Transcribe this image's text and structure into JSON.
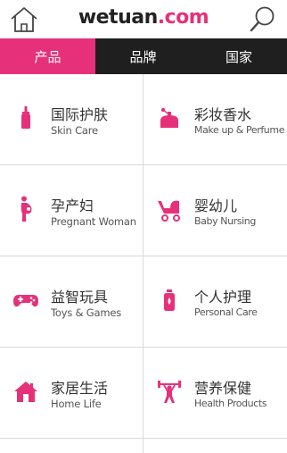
{
  "header": {
    "logo_part1": "wetuan",
    "logo_part2": ".com",
    "home_icon": "home-icon",
    "search_icon": "search-icon"
  },
  "tabs": [
    {
      "label": "产品",
      "active": true
    },
    {
      "label": "品牌",
      "active": false
    },
    {
      "label": "国家",
      "active": false
    }
  ],
  "categories": [
    {
      "zh": "国际护肤",
      "en": "Skin Care",
      "icon": "bottle-icon"
    },
    {
      "zh": "彩妆香水",
      "en": "Make up & Perfume",
      "icon": "perfume-icon"
    },
    {
      "zh": "孕产妇",
      "en": "Pregnant Woman",
      "icon": "pregnant-woman-icon"
    },
    {
      "zh": "婴幼儿",
      "en": "Baby Nursing",
      "icon": "stroller-icon"
    },
    {
      "zh": "益智玩具",
      "en": "Toys & Games",
      "icon": "gamepad-icon"
    },
    {
      "zh": "个人护理",
      "en": "Personal Care",
      "icon": "personal-care-icon"
    },
    {
      "zh": "家居生活",
      "en": "Home Life",
      "icon": "house-icon"
    },
    {
      "zh": "营养保健",
      "en": "Health Products",
      "icon": "weightlifter-icon"
    }
  ],
  "colors": {
    "accent": "#e6317a",
    "tabbar": "#1f1f1f",
    "divider": "#d9d9d9"
  }
}
